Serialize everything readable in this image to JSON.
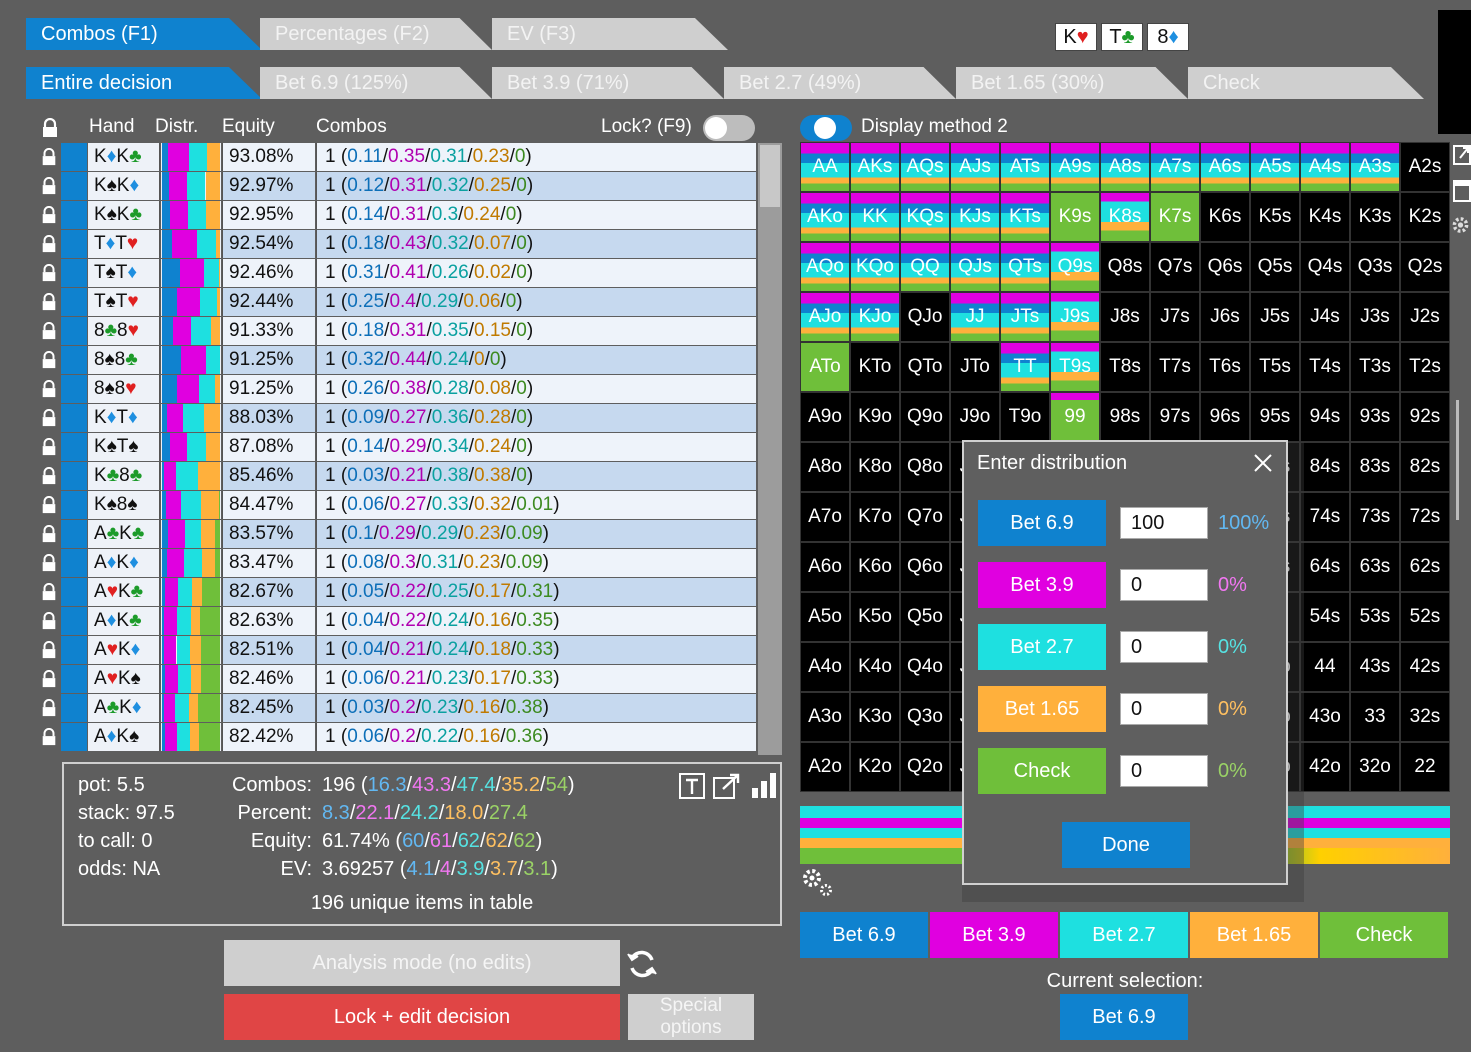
{
  "colors": {
    "bet69": "#0f82cf",
    "bet39": "#e000e0",
    "bet27": "#1ee0e0",
    "bet165": "#ffb03c",
    "check": "#6fbf3a",
    "lock": "#e04545"
  },
  "tabs_top": [
    {
      "label": "Combos (F1)",
      "active": true
    },
    {
      "label": "Percentages (F2)",
      "active": false
    },
    {
      "label": "EV (F3)",
      "active": false
    }
  ],
  "tabs_decision": [
    {
      "label": "Entire decision",
      "active": true
    },
    {
      "label": "Bet 6.9 (125%)",
      "active": false
    },
    {
      "label": "Bet 3.9 (71%)",
      "active": false
    },
    {
      "label": "Bet 2.7 (49%)",
      "active": false
    },
    {
      "label": "Bet 1.65 (30%)",
      "active": false
    },
    {
      "label": "Check",
      "active": false
    }
  ],
  "board": [
    {
      "rank": "K",
      "suit": "♥",
      "cls": "h"
    },
    {
      "rank": "T",
      "suit": "♣",
      "cls": "c"
    },
    {
      "rank": "8",
      "suit": "♦",
      "cls": "d"
    }
  ],
  "table": {
    "headers": {
      "hand": "Hand",
      "distr": "Distr.",
      "equity": "Equity",
      "combos": "Combos",
      "lock": "Lock? (F9)"
    },
    "rows": [
      {
        "hand": "K♦K♣",
        "equity": "93.08%",
        "w": "1",
        "v": [
          "0.11",
          "0.35",
          "0.31",
          "0.23",
          "0"
        ]
      },
      {
        "hand": "K♠K♦",
        "equity": "92.97%",
        "w": "1",
        "v": [
          "0.12",
          "0.31",
          "0.32",
          "0.25",
          "0"
        ]
      },
      {
        "hand": "K♠K♣",
        "equity": "92.95%",
        "w": "1",
        "v": [
          "0.14",
          "0.31",
          "0.3",
          "0.24",
          "0"
        ]
      },
      {
        "hand": "T♦T♥",
        "equity": "92.54%",
        "w": "1",
        "v": [
          "0.18",
          "0.43",
          "0.32",
          "0.07",
          "0"
        ]
      },
      {
        "hand": "T♠T♦",
        "equity": "92.46%",
        "w": "1",
        "v": [
          "0.31",
          "0.41",
          "0.26",
          "0.02",
          "0"
        ]
      },
      {
        "hand": "T♠T♥",
        "equity": "92.44%",
        "w": "1",
        "v": [
          "0.25",
          "0.4",
          "0.29",
          "0.06",
          "0"
        ]
      },
      {
        "hand": "8♣8♥",
        "equity": "91.33%",
        "w": "1",
        "v": [
          "0.18",
          "0.31",
          "0.35",
          "0.15",
          "0"
        ]
      },
      {
        "hand": "8♠8♣",
        "equity": "91.25%",
        "w": "1",
        "v": [
          "0.32",
          "0.44",
          "0.24",
          "0",
          "0"
        ]
      },
      {
        "hand": "8♠8♥",
        "equity": "91.25%",
        "w": "1",
        "v": [
          "0.26",
          "0.38",
          "0.28",
          "0.08",
          "0"
        ]
      },
      {
        "hand": "K♦T♦",
        "equity": "88.03%",
        "w": "1",
        "v": [
          "0.09",
          "0.27",
          "0.36",
          "0.28",
          "0"
        ]
      },
      {
        "hand": "K♠T♠",
        "equity": "87.08%",
        "w": "1",
        "v": [
          "0.14",
          "0.29",
          "0.34",
          "0.24",
          "0"
        ]
      },
      {
        "hand": "K♣8♣",
        "equity": "85.46%",
        "w": "1",
        "v": [
          "0.03",
          "0.21",
          "0.38",
          "0.38",
          "0"
        ]
      },
      {
        "hand": "K♠8♠",
        "equity": "84.47%",
        "w": "1",
        "v": [
          "0.06",
          "0.27",
          "0.33",
          "0.32",
          "0.01"
        ]
      },
      {
        "hand": "A♣K♣",
        "equity": "83.57%",
        "w": "1",
        "v": [
          "0.1",
          "0.29",
          "0.29",
          "0.23",
          "0.09"
        ]
      },
      {
        "hand": "A♦K♦",
        "equity": "83.47%",
        "w": "1",
        "v": [
          "0.08",
          "0.3",
          "0.31",
          "0.23",
          "0.09"
        ]
      },
      {
        "hand": "A♥K♣",
        "equity": "82.67%",
        "w": "1",
        "v": [
          "0.05",
          "0.22",
          "0.25",
          "0.17",
          "0.31"
        ]
      },
      {
        "hand": "A♦K♣",
        "equity": "82.63%",
        "w": "1",
        "v": [
          "0.04",
          "0.22",
          "0.24",
          "0.16",
          "0.35"
        ]
      },
      {
        "hand": "A♥K♦",
        "equity": "82.51%",
        "w": "1",
        "v": [
          "0.04",
          "0.21",
          "0.24",
          "0.18",
          "0.33"
        ]
      },
      {
        "hand": "A♥K♠",
        "equity": "82.46%",
        "w": "1",
        "v": [
          "0.06",
          "0.21",
          "0.23",
          "0.17",
          "0.33"
        ]
      },
      {
        "hand": "A♣K♦",
        "equity": "82.45%",
        "w": "1",
        "v": [
          "0.03",
          "0.2",
          "0.23",
          "0.16",
          "0.38"
        ]
      },
      {
        "hand": "A♦K♠",
        "equity": "82.42%",
        "w": "1",
        "v": [
          "0.06",
          "0.2",
          "0.22",
          "0.16",
          "0.36"
        ]
      }
    ]
  },
  "stats": {
    "pot": "pot: 5.5",
    "stack": "stack: 97.5",
    "tocall": "to call: 0",
    "odds": "odds: NA",
    "combos_label": "Combos:",
    "combos_total": "196",
    "combos_parts": [
      "16.3",
      "43.3",
      "47.4",
      "35.2",
      "54"
    ],
    "percent_label": "Percent:",
    "percent_parts": [
      "8.3",
      "22.1",
      "24.2",
      "18.0",
      "27.4"
    ],
    "equity_label": "Equity:",
    "equity_total": "61.74%",
    "equity_parts": [
      "60",
      "61",
      "62",
      "62",
      "62"
    ],
    "ev_label": "EV:",
    "ev_total": "3.69257",
    "ev_parts": [
      "4.1",
      "4",
      "3.9",
      "3.7",
      "3.1"
    ],
    "unique": "196 unique items in table"
  },
  "buttons": {
    "analysis": "Analysis mode (no edits)",
    "lock_edit": "Lock + edit decision",
    "special": "Special options"
  },
  "display_method": "Display method 2",
  "grid": {
    "ranks": [
      "A",
      "K",
      "Q",
      "J",
      "T",
      "9",
      "8",
      "7",
      "6",
      "5",
      "4",
      "3",
      "2"
    ]
  },
  "dialog": {
    "title": "Enter distribution",
    "rows": [
      {
        "label": "Bet 6.9",
        "value": "100",
        "pct": "100%"
      },
      {
        "label": "Bet 3.9",
        "value": "0",
        "pct": "0%"
      },
      {
        "label": "Bet 2.7",
        "value": "0",
        "pct": "0%"
      },
      {
        "label": "Bet 1.65",
        "value": "0",
        "pct": "0%"
      },
      {
        "label": "Check",
        "value": "0",
        "pct": "0%"
      }
    ],
    "done": "Done"
  },
  "actions": [
    "Bet 6.9",
    "Bet 3.9",
    "Bet 2.7",
    "Bet 1.65",
    "Check"
  ],
  "current_selection_label": "Current selection:",
  "current_selection": "Bet 6.9"
}
